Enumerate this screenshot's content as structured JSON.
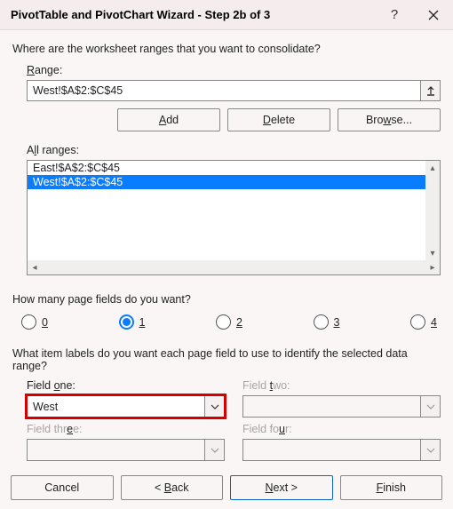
{
  "title": "PivotTable and PivotChart Wizard - Step 2b of 3",
  "q1": "Where are the worksheet ranges that you want to consolidate?",
  "range_label": "Range:",
  "range_value": "West!$A$2:$C$45",
  "buttons": {
    "add": "Add",
    "delete": "Delete",
    "browse": "Browse..."
  },
  "allranges_label": "All ranges:",
  "ranges": [
    "East!$A$2:$C$45",
    "West!$A$2:$C$45"
  ],
  "q2": "How many page fields do you want?",
  "radios": {
    "r0": "0",
    "r1": "1",
    "r2": "2",
    "r3": "3",
    "r4": "4"
  },
  "q3": "What item labels do you want each page field to use to identify the selected data range?",
  "fields": {
    "f1_label": "Field one:",
    "f1_value": "West",
    "f2_label": "Field two:",
    "f3_label": "Field three:",
    "f4_label": "Field four:"
  },
  "nav": {
    "cancel": "Cancel",
    "back": "< Back",
    "next": "Next >",
    "finish": "Finish"
  }
}
